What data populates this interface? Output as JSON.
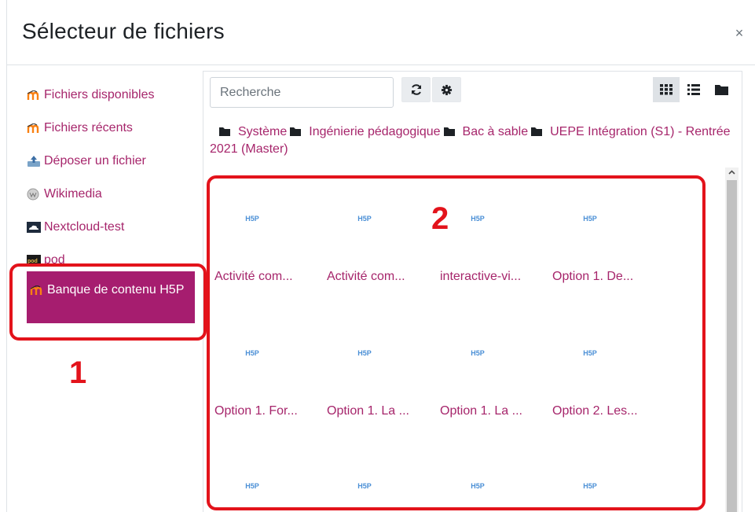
{
  "dialog": {
    "title": "Sélecteur de fichiers",
    "close_label": "×"
  },
  "sidebar": {
    "items": [
      {
        "label": "Fichiers disponibles",
        "icon": "moodle-icon"
      },
      {
        "label": "Fichiers récents",
        "icon": "moodle-icon"
      },
      {
        "label": "Déposer un fichier",
        "icon": "upload-icon"
      },
      {
        "label": "Wikimedia",
        "icon": "wikimedia-icon"
      },
      {
        "label": "Nextcloud-test",
        "icon": "nextcloud-icon"
      },
      {
        "label": "pod",
        "icon": "pod-icon"
      },
      {
        "label": "Banque de contenu H5P",
        "icon": "moodle-icon",
        "active": true
      }
    ]
  },
  "toolbar": {
    "search_placeholder": "Recherche",
    "refresh_icon": "refresh-icon",
    "settings_icon": "gear-icon",
    "views": [
      "grid-view-icon",
      "list-view-icon",
      "folder-view-icon"
    ]
  },
  "breadcrumb": [
    {
      "label": "Système"
    },
    {
      "label": "Ingénierie pédagogique"
    },
    {
      "label": "Bac à sable"
    },
    {
      "label": "UEPE Intégration (S1) - Rentrée 2021 (Master)"
    }
  ],
  "files": [
    {
      "name": "Activité com...",
      "thumb": "H5P"
    },
    {
      "name": "Activité com...",
      "thumb": "H5P"
    },
    {
      "name": "interactive-vi...",
      "thumb": "H5P"
    },
    {
      "name": "Option 1. De...",
      "thumb": "H5P"
    },
    {
      "name": "Option 1. For...",
      "thumb": "H5P"
    },
    {
      "name": "Option 1. La ...",
      "thumb": "H5P"
    },
    {
      "name": "Option 1. La ...",
      "thumb": "H5P"
    },
    {
      "name": "Option 2. Les...",
      "thumb": "H5P"
    },
    {
      "name": "",
      "thumb": "H5P"
    },
    {
      "name": "",
      "thumb": "H5P"
    },
    {
      "name": "",
      "thumb": "H5P"
    },
    {
      "name": "",
      "thumb": "H5P"
    }
  ],
  "annotations": {
    "label_1": "1",
    "label_2": "2",
    "color": "#e3131b"
  },
  "colors": {
    "accent": "#a61d6f",
    "link": "#a6256b"
  }
}
